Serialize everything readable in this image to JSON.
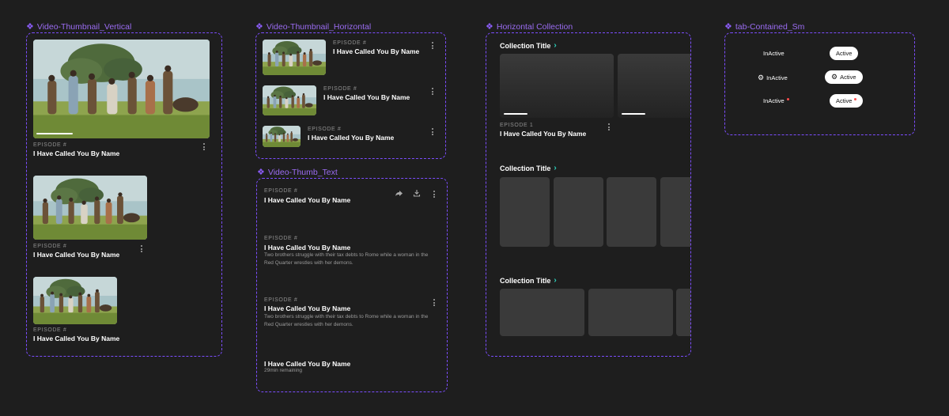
{
  "frames": {
    "vertical": "Video-Thumbnail_Vertical",
    "horizontal": "Video-Thumbnail_Horizontal",
    "thumb_text": "Video-Thumb_Text",
    "collection": "Horizontal Collection",
    "tabs": "tab-Contained_Sm"
  },
  "episode_label": "EPISODE #",
  "episode_1_label": "EPISODE 1",
  "episode_title": "I Have Called You By Name",
  "description": "Two brothers struggle with their tax debts to Rome while a woman in the Red Quarter wrestles with her demons.",
  "remaining": "29min remaining",
  "collection_title": "Collection Title",
  "tabs": {
    "inactive": "InActive",
    "active": "Active"
  },
  "icons": [
    "more-vertical-icon",
    "share-icon",
    "download-icon",
    "gear-icon",
    "chevron-right-icon"
  ],
  "colors": {
    "frame_border": "#7c4dff",
    "frame_label": "#9b6cf2",
    "chevron": "#2dd4bf",
    "notification_dot": "#ff4d4d",
    "background": "#1e1e1e"
  }
}
